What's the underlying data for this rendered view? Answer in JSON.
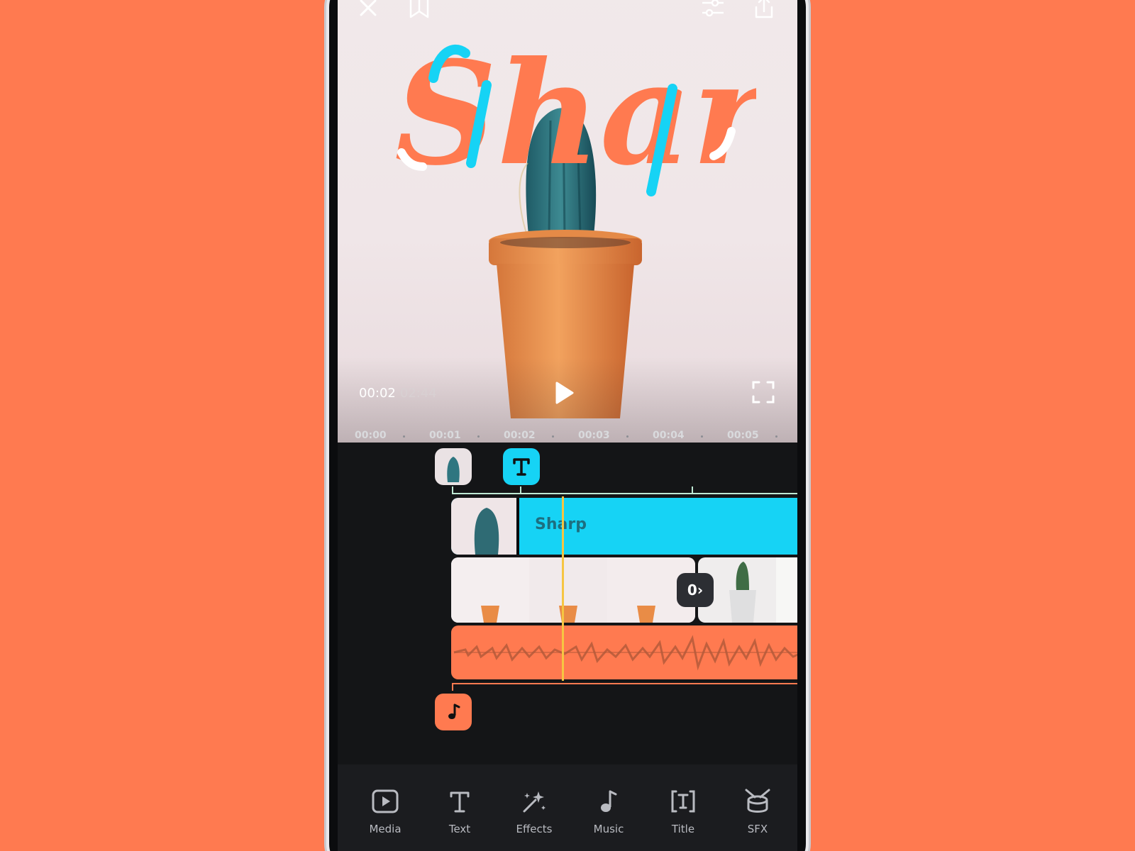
{
  "preview": {
    "title_text": "Sharp",
    "current_time": "00:02",
    "total_time": "02:44"
  },
  "ruler": {
    "ticks": [
      "00:00",
      "00:01",
      "00:02",
      "00:03",
      "00:04",
      "00:05"
    ]
  },
  "timeline": {
    "text_clip_label": "Sharp",
    "transition_symbol": "0›"
  },
  "toolbar": {
    "items": [
      {
        "label": "Media",
        "icon": "media-icon"
      },
      {
        "label": "Text",
        "icon": "text-icon"
      },
      {
        "label": "Effects",
        "icon": "effects-icon"
      },
      {
        "label": "Music",
        "icon": "music-icon"
      },
      {
        "label": "Title",
        "icon": "title-icon"
      },
      {
        "label": "SFX",
        "icon": "sfx-icon"
      }
    ]
  },
  "colors": {
    "background": "#FF7A50",
    "accent_cyan": "#16D3F5",
    "accent_orange": "#FF7A50",
    "playhead": "#F6C542"
  }
}
